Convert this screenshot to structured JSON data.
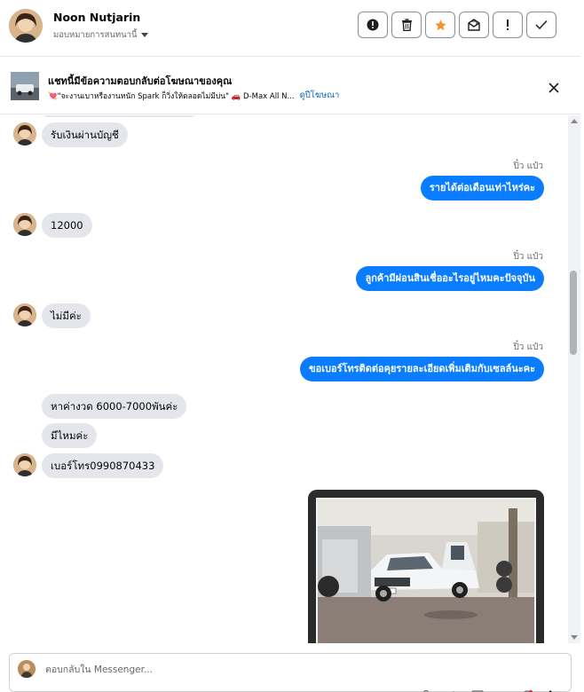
{
  "header": {
    "contact_name": "Noon Nutjarin",
    "assign_label": "มอบหมายการสนทนานี้",
    "actions": [
      {
        "icon": "alert-circle-icon",
        "name": "mark-important-button"
      },
      {
        "icon": "trash-icon",
        "name": "delete-button"
      },
      {
        "icon": "star-icon",
        "name": "star-button"
      },
      {
        "icon": "mail-open-icon",
        "name": "mark-unread-button"
      },
      {
        "icon": "exclamation-icon",
        "name": "spam-button"
      },
      {
        "icon": "check-icon",
        "name": "done-button"
      }
    ],
    "star_color": "#f5922f"
  },
  "ad_bar": {
    "title": "แชทนี้มีข้อความตอบกลับต่อโฆษณาของคุณ",
    "ad_text": "💘\"จะงานเบาหรืองานหนัก Spark ก็วิ่งให้ตลอดไม่มีบ่น\" 🚗 D-Max All N...",
    "view_ad_label": "ดูปีโฆษณา"
  },
  "messages": {
    "m1": "รับเงินผ่านบัญชี",
    "s2": "ปิ๋ว แป๋ว",
    "m2": "รายได้ต่อเดือนเท่าไหร่คะ",
    "m3": "12000",
    "s4": "ปิ๋ว แป๋ว",
    "m4": "ลูกค้ามีผ่อนสินเชื่ออะไรอยู่ไหมคะปัจจุบัน",
    "m5": "ไม่มีค่ะ",
    "s6": "ปิ๋ว แป๋ว",
    "m6": "ขอเบอร์โทรติดต่อคุยรายละเอียดเพิ่มเติมกับเซลล์นะคะ",
    "m7": "หาค่างวด 6000-7000พันค่ะ",
    "m8": "มีไหมค่ะ",
    "m9": "เบอร์โทร0990870433"
  },
  "composer": {
    "placeholder": "ตอบกลับใน Messenger..."
  },
  "colors": {
    "outgoing_bubble": "#0a7cff",
    "incoming_bubble": "#e4e6eb"
  }
}
